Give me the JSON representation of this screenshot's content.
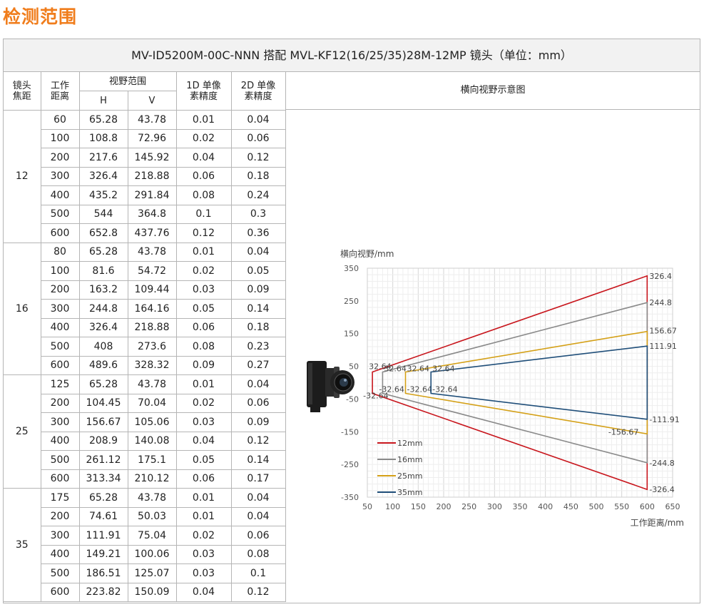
{
  "page_title": "检测范围",
  "banner": "MV-ID5200M-00C-NNN 搭配 MVL-KF12(16/25/35)28M-12MP 镜头（单位：mm）",
  "headers": {
    "focal_1": "镜头",
    "focal_2": "焦距",
    "wd_1": "工作",
    "wd_2": "距离",
    "fov": "视野范围",
    "h": "H",
    "v": "V",
    "p1d_1": "1D 单像",
    "p1d_2": "素精度",
    "p2d_1": "2D 单像",
    "p2d_2": "素精度",
    "diagram": "横向视野示意图"
  },
  "groups": [
    {
      "focal": "12",
      "rows": [
        [
          "60",
          "65.28",
          "43.78",
          "0.01",
          "0.04"
        ],
        [
          "100",
          "108.8",
          "72.96",
          "0.02",
          "0.06"
        ],
        [
          "200",
          "217.6",
          "145.92",
          "0.04",
          "0.12"
        ],
        [
          "300",
          "326.4",
          "218.88",
          "0.06",
          "0.18"
        ],
        [
          "400",
          "435.2",
          "291.84",
          "0.08",
          "0.24"
        ],
        [
          "500",
          "544",
          "364.8",
          "0.1",
          "0.3"
        ],
        [
          "600",
          "652.8",
          "437.76",
          "0.12",
          "0.36"
        ]
      ]
    },
    {
      "focal": "16",
      "rows": [
        [
          "80",
          "65.28",
          "43.78",
          "0.01",
          "0.04"
        ],
        [
          "100",
          "81.6",
          "54.72",
          "0.02",
          "0.05"
        ],
        [
          "200",
          "163.2",
          "109.44",
          "0.03",
          "0.09"
        ],
        [
          "300",
          "244.8",
          "164.16",
          "0.05",
          "0.14"
        ],
        [
          "400",
          "326.4",
          "218.88",
          "0.06",
          "0.18"
        ],
        [
          "500",
          "408",
          "273.6",
          "0.08",
          "0.23"
        ],
        [
          "600",
          "489.6",
          "328.32",
          "0.09",
          "0.27"
        ]
      ]
    },
    {
      "focal": "25",
      "rows": [
        [
          "125",
          "65.28",
          "43.78",
          "0.01",
          "0.04"
        ],
        [
          "200",
          "104.45",
          "70.04",
          "0.02",
          "0.06"
        ],
        [
          "300",
          "156.67",
          "105.06",
          "0.03",
          "0.09"
        ],
        [
          "400",
          "208.9",
          "140.08",
          "0.04",
          "0.12"
        ],
        [
          "500",
          "261.12",
          "175.1",
          "0.05",
          "0.14"
        ],
        [
          "600",
          "313.34",
          "210.12",
          "0.06",
          "0.17"
        ]
      ]
    },
    {
      "focal": "35",
      "rows": [
        [
          "175",
          "65.28",
          "43.78",
          "0.01",
          "0.04"
        ],
        [
          "200",
          "74.61",
          "50.03",
          "0.01",
          "0.04"
        ],
        [
          "300",
          "111.91",
          "75.04",
          "0.02",
          "0.06"
        ],
        [
          "400",
          "149.21",
          "100.06",
          "0.03",
          "0.08"
        ],
        [
          "500",
          "186.51",
          "125.07",
          "0.03",
          "0.1"
        ],
        [
          "600",
          "223.82",
          "150.09",
          "0.04",
          "0.12"
        ]
      ]
    }
  ],
  "camera_icon": "industrial-camera-icon",
  "chart_data": {
    "type": "line",
    "ylabel": "横向视野/mm",
    "xlabel": "工作距离/mm",
    "xlim": [
      50,
      650
    ],
    "ylim": [
      -350,
      350
    ],
    "xticks": [
      "50",
      "100",
      "150",
      "200",
      "250",
      "300",
      "350",
      "400",
      "450",
      "500",
      "550",
      "600",
      "650"
    ],
    "yticks": [
      "350",
      "250",
      "150",
      "50",
      "-50",
      "-150",
      "-250",
      "-350"
    ],
    "series": [
      {
        "name": "12mm",
        "color": "#c8161d",
        "near_x": 60,
        "far_x": 600,
        "near_half": 32.64,
        "far_half": 326.4,
        "near_labels": [
          "32.64",
          "-32.64"
        ],
        "far_labels": [
          "326.4",
          "-326.4"
        ]
      },
      {
        "name": "16mm",
        "color": "#8a8a8a",
        "near_x": 80,
        "far_x": 600,
        "near_half": 32.64,
        "far_half": 244.8,
        "near_labels": [
          "32.64",
          "-32.64"
        ],
        "far_labels": [
          "244.8",
          "-244.8"
        ]
      },
      {
        "name": "25mm",
        "color": "#d4a017",
        "near_x": 125,
        "far_x": 600,
        "near_half": 32.64,
        "far_half": 156.67,
        "near_labels": [
          "32.64",
          "-32.64"
        ],
        "far_labels": [
          "156.67",
          "-156.67"
        ]
      },
      {
        "name": "35mm",
        "color": "#1f4e79",
        "near_x": 175,
        "far_x": 600,
        "near_half": 32.64,
        "far_half": 111.91,
        "near_labels": [
          "32.64",
          "-32.64"
        ],
        "far_labels": [
          "111.91",
          "-111.91"
        ]
      }
    ]
  }
}
